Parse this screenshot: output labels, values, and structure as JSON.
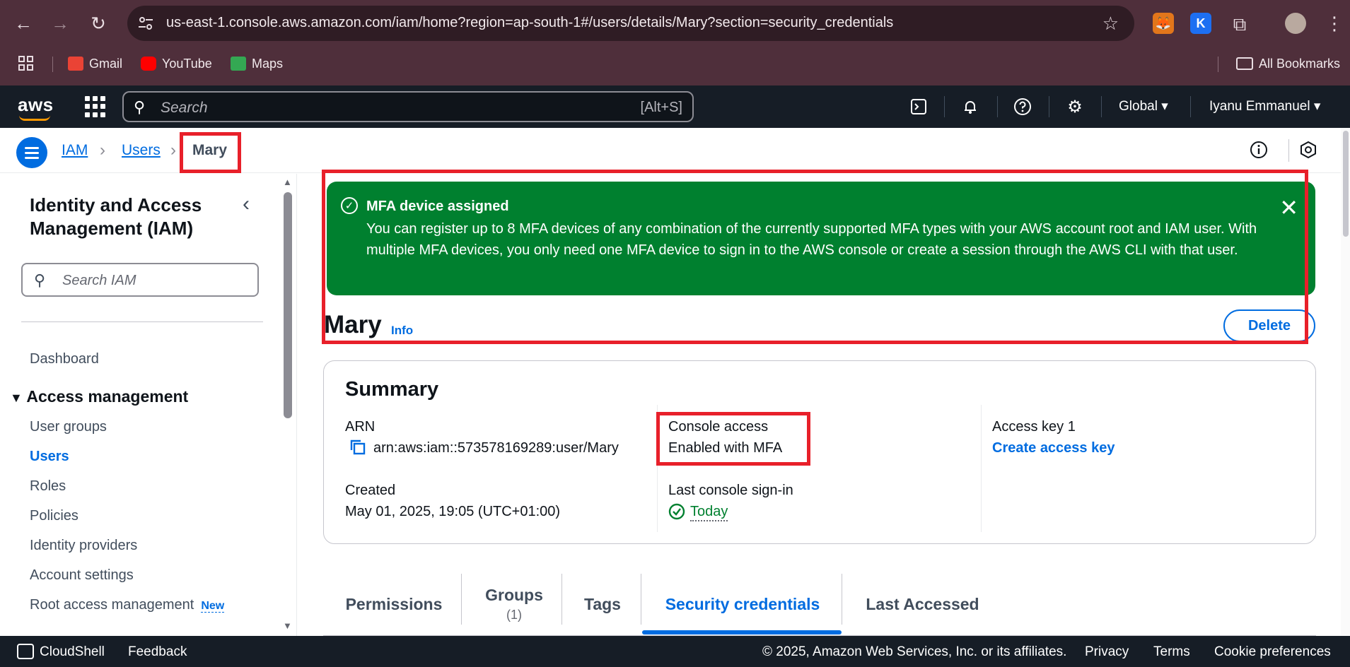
{
  "browser": {
    "url": "us-east-1.console.aws.amazon.com/iam/home?region=ap-south-1#/users/details/Mary?section=security_credentials",
    "bookmarks": [
      "Gmail",
      "YouTube",
      "Maps"
    ],
    "all_bookmarks": "All Bookmarks",
    "extension_k_label": "K"
  },
  "aws_nav": {
    "logo": "aws",
    "search_placeholder": "Search",
    "search_shortcut": "[Alt+S]",
    "region": "Global",
    "user": "Iyanu Emmanuel"
  },
  "breadcrumb": [
    "IAM",
    "Users",
    "Mary"
  ],
  "sidebar": {
    "title": "Identity and Access Management (IAM)",
    "search_placeholder": "Search IAM",
    "dashboard": "Dashboard",
    "section": "Access management",
    "items": [
      "User groups",
      "Users",
      "Roles",
      "Policies",
      "Identity providers",
      "Account settings",
      "Root access management"
    ],
    "new_badge": "New"
  },
  "flash": {
    "title": "MFA device assigned",
    "message": "You can register up to 8 MFA devices of any combination of the currently supported MFA types with your AWS account root and IAM user. With multiple MFA devices, you only need one MFA device to sign in to the AWS console or create a session through the AWS CLI with that user."
  },
  "page": {
    "title": "Mary",
    "info": "Info",
    "delete": "Delete"
  },
  "summary": {
    "title": "Summary",
    "arn_label": "ARN",
    "arn_value": "arn:aws:iam::573578169289:user/Mary",
    "created_label": "Created",
    "created_value": "May 01, 2025, 19:05 (UTC+01:00)",
    "console_label": "Console access",
    "console_value": "Enabled with MFA",
    "last_signin_label": "Last console sign-in",
    "last_signin_value": "Today",
    "access_key_label": "Access key 1",
    "access_key_link": "Create access key"
  },
  "tabs": [
    {
      "label": "Permissions"
    },
    {
      "label": "Groups",
      "count": "(1)"
    },
    {
      "label": "Tags"
    },
    {
      "label": "Security credentials"
    },
    {
      "label": "Last Accessed"
    }
  ],
  "footer": {
    "cloudshell": "CloudShell",
    "feedback": "Feedback",
    "copyright": "© 2025, Amazon Web Services, Inc. or its affiliates.",
    "privacy": "Privacy",
    "terms": "Terms",
    "cookies": "Cookie preferences"
  },
  "colors": {
    "accent": "#006ce0",
    "success": "#00802f",
    "highlight": "#e8202a",
    "nav_bg": "#161d26"
  }
}
